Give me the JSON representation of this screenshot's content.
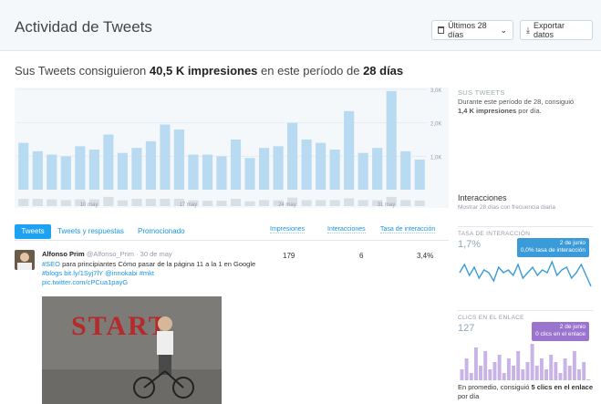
{
  "header": {
    "title": "Actividad de Tweets",
    "range_button": "Últimos 28 días",
    "export_button": "Exportar datos"
  },
  "summary": {
    "prefix": "Sus Tweets consiguieron ",
    "impressions": "40,5 K impresiones",
    "middle": " en este período de ",
    "period": "28 días"
  },
  "chart_data": {
    "type": "bar",
    "x_ticks": [
      "10 may",
      "17 may",
      "24 may",
      "31 may"
    ],
    "y_ticks": [
      "3,0K",
      "2,0K",
      "1,0K"
    ],
    "ylim": [
      0,
      3000
    ],
    "series": [
      {
        "values": [
          1400,
          1150,
          1050,
          1000,
          1300,
          1200,
          1650,
          1100,
          1250,
          1450,
          1950,
          1800,
          1050,
          1050,
          1000,
          1500,
          950,
          1250,
          1300,
          2000,
          1500,
          1400,
          1200,
          2350,
          1100,
          1250,
          2950,
          1150,
          900
        ]
      },
      {
        "values": [
          300,
          300,
          280,
          250,
          280,
          280,
          380,
          240,
          300,
          300,
          300,
          300,
          240,
          220,
          220,
          300,
          200,
          250,
          240,
          350,
          250,
          250,
          250,
          320,
          250,
          250,
          380,
          250,
          230
        ]
      }
    ]
  },
  "side_summary": {
    "title": "SUS TWEETS",
    "line1": "Durante este período de 28, consiguió",
    "bold": "1,4 K impresiones",
    "line2": " por día."
  },
  "tabs": {
    "tweets": "Tweets",
    "replies": "Tweets y respuestas",
    "promoted": "Promocionado"
  },
  "columns": {
    "impressions": "Impresiones",
    "interactions": "Interacciones",
    "rate": "Tasa de interacción"
  },
  "tweet": {
    "name": "Alfonso Prim",
    "handle": "@Alfonso_Prim",
    "date": "· 30 de may",
    "text1": " para principiantes Cómo pasar de la página 11 a la 1 en Google ",
    "hashtag_seo": "#SEO",
    "hashtag_blogs": "#blogs",
    "link": "bit.ly/1Syj7lY",
    "mention": "@innokabi",
    "hashtag_mkt": "#mkt",
    "pic": "pic.twitter.com/cPCua1payG",
    "impressions": "179",
    "interactions": "6",
    "rate": "3,4%",
    "image_text": "START"
  },
  "interactions": {
    "title": "Interacciones",
    "subtitle": "Mostrar 28 días con frecuencia diaria"
  },
  "rate_card": {
    "label": "TASA DE INTERACCIÓN",
    "value": "1,7%",
    "tip_date": "2 de junio",
    "tip_text": "0,0% tasa de interacción",
    "values": [
      1.6,
      1.9,
      1.5,
      1.8,
      1.4,
      1.7,
      1.6,
      1.3,
      1.8,
      1.6,
      1.7,
      1.5,
      1.9,
      1.4,
      1.6,
      1.8,
      1.5,
      1.7,
      1.6,
      2.0,
      1.5,
      1.7,
      1.8,
      1.4,
      1.6,
      1.9,
      1.5,
      1.1
    ]
  },
  "clicks_card": {
    "label": "CLICS EN EL ENLACE",
    "value": "127",
    "tip_date": "2 de junio",
    "tip_text": "0 clics en el enlace",
    "values": [
      3,
      6,
      2,
      9,
      4,
      8,
      3,
      5,
      7,
      2,
      6,
      4,
      8,
      3,
      5,
      10,
      4,
      6,
      3,
      7,
      5,
      2,
      6,
      4,
      8,
      3,
      5,
      0
    ],
    "foot_prefix": "En promedio, consiguió ",
    "foot_bold": "5 clics en el enlace",
    "foot_suffix": " por día"
  },
  "colors": {
    "bar_main": "#b9dbf2",
    "bar_secondary": "#d9e0e5",
    "accent": "#1da1f2",
    "rate_line": "#3b9bd8",
    "clicks_bar": "#c9b3e6"
  }
}
